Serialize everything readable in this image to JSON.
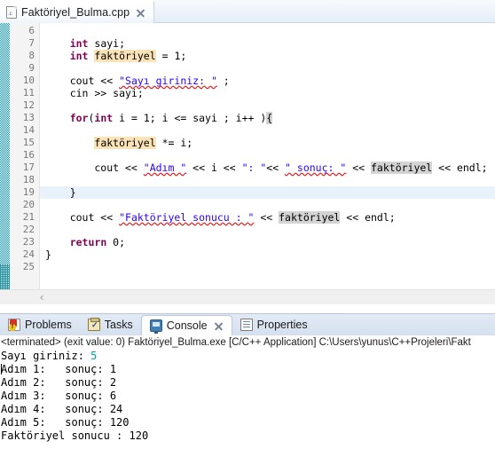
{
  "editor": {
    "tab": {
      "title": "Faktöriyel_Bulma.cpp",
      "icon": "c-file-icon",
      "letter": ".c",
      "close_icon": "close-icon"
    },
    "first_visible_line": 6,
    "cursor_line": 19,
    "lines": [
      {
        "n": 6,
        "tokens": []
      },
      {
        "n": 7,
        "tokens": [
          {
            "t": "    ",
            "c": "plain"
          },
          {
            "t": "int",
            "c": "kw"
          },
          {
            "t": " sayi;",
            "c": "plain"
          }
        ]
      },
      {
        "n": 8,
        "tokens": [
          {
            "t": "    ",
            "c": "plain"
          },
          {
            "t": "int",
            "c": "kw"
          },
          {
            "t": " ",
            "c": "plain"
          },
          {
            "t": "faktöriyel",
            "c": "hl-occ"
          },
          {
            "t": " = 1;",
            "c": "plain"
          }
        ]
      },
      {
        "n": 9,
        "tokens": []
      },
      {
        "n": 10,
        "tokens": [
          {
            "t": "    cout << ",
            "c": "plain"
          },
          {
            "t": "\"Sayı giriniz: \"",
            "c": "str"
          },
          {
            "t": " ;",
            "c": "plain"
          }
        ]
      },
      {
        "n": 11,
        "tokens": [
          {
            "t": "    cin >> sayi;",
            "c": "plain"
          }
        ]
      },
      {
        "n": 12,
        "tokens": []
      },
      {
        "n": 13,
        "tokens": [
          {
            "t": "    ",
            "c": "plain"
          },
          {
            "t": "for",
            "c": "kw"
          },
          {
            "t": "(",
            "c": "plain"
          },
          {
            "t": "int",
            "c": "kw"
          },
          {
            "t": " i = 1; i <= sayi ; i++ )",
            "c": "plain"
          },
          {
            "t": "{",
            "c": "hl-brk"
          }
        ]
      },
      {
        "n": 14,
        "tokens": []
      },
      {
        "n": 15,
        "tokens": [
          {
            "t": "        ",
            "c": "plain"
          },
          {
            "t": "faktöriyel",
            "c": "hl-occ"
          },
          {
            "t": " *= i;",
            "c": "plain"
          }
        ]
      },
      {
        "n": 16,
        "tokens": []
      },
      {
        "n": 17,
        "tokens": [
          {
            "t": "        cout << ",
            "c": "plain"
          },
          {
            "t": "\"Adım \"",
            "c": "str"
          },
          {
            "t": " << i << ",
            "c": "plain"
          },
          {
            "t": "\": \"",
            "c": "strplain"
          },
          {
            "t": "<< ",
            "c": "plain"
          },
          {
            "t": "\" sonuç: \"",
            "c": "str"
          },
          {
            "t": " << ",
            "c": "plain"
          },
          {
            "t": "faktöriyel",
            "c": "hl-sel"
          },
          {
            "t": " << endl;",
            "c": "plain"
          }
        ]
      },
      {
        "n": 18,
        "tokens": []
      },
      {
        "n": 19,
        "tokens": [
          {
            "t": "    }",
            "c": "plain"
          }
        ]
      },
      {
        "n": 20,
        "tokens": []
      },
      {
        "n": 21,
        "tokens": [
          {
            "t": "    cout << ",
            "c": "plain"
          },
          {
            "t": "\"Faktöriyel sonucu : \"",
            "c": "str"
          },
          {
            "t": " << ",
            "c": "plain"
          },
          {
            "t": "faktöriyel",
            "c": "hl-sel"
          },
          {
            "t": " << endl;",
            "c": "plain"
          }
        ]
      },
      {
        "n": 22,
        "tokens": []
      },
      {
        "n": 23,
        "tokens": [
          {
            "t": "    ",
            "c": "plain"
          },
          {
            "t": "return",
            "c": "kw"
          },
          {
            "t": " 0;",
            "c": "plain"
          }
        ]
      },
      {
        "n": 24,
        "tokens": [
          {
            "t": "}",
            "c": "plain"
          }
        ]
      },
      {
        "n": 25,
        "tokens": []
      }
    ],
    "hscroll_left_arrow": "‹"
  },
  "bottom_view": {
    "tabs": [
      {
        "label": "Problems",
        "icon": "problems-icon",
        "active": false,
        "closable": false
      },
      {
        "label": "Tasks",
        "icon": "tasks-icon",
        "active": false,
        "closable": false
      },
      {
        "label": "Console",
        "icon": "console-icon",
        "active": true,
        "closable": true
      },
      {
        "label": "Properties",
        "icon": "properties-icon",
        "active": false,
        "closable": false
      }
    ]
  },
  "console": {
    "status_line": "<terminated> (exit value: 0) Faktöriyel_Bulma.exe [C/C++ Application] C:\\Users\\yunus\\C++Projeleri\\Fakt",
    "output": [
      {
        "text": "Sayı giriniz: ",
        "input": "5"
      },
      {
        "text": "Adım 1:   sonuç: 1",
        "caret": true
      },
      {
        "text": "Adım 2:   sonuç: 2"
      },
      {
        "text": "Adım 3:   sonuç: 6"
      },
      {
        "text": "Adım 4:   sonuç: 24"
      },
      {
        "text": "Adım 5:   sonuç: 120"
      },
      {
        "text": "Faktöriyel sonucu : 120"
      }
    ]
  },
  "colors": {
    "keyword": "#7F0055",
    "string": "#2A00FF",
    "occurrence_highlight": "#FBE3B8",
    "selection_highlight": "#D4D4D4",
    "cursor_line": "#E9F2FB",
    "console_input": "#00A0A0",
    "tabbar": "#D5E0EE"
  }
}
